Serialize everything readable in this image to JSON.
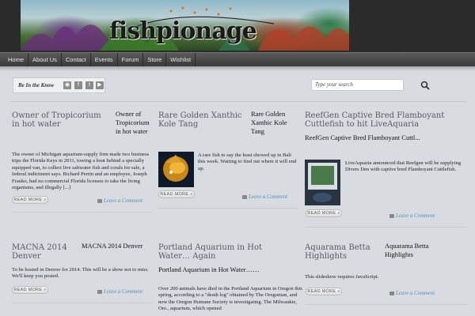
{
  "site": {
    "logo_text": "fishpionage"
  },
  "nav": {
    "items": [
      "Home",
      "About Us",
      "Contact",
      "Events",
      "Forum",
      "Store",
      "Wishlist"
    ]
  },
  "social": {
    "label": "Be In the Know",
    "icons": [
      "rss-icon",
      "facebook-icon",
      "twitter-icon",
      "youtube-icon"
    ]
  },
  "search": {
    "placeholder": "Type your search"
  },
  "posts": [
    {
      "title": "Owner of Tropicorium in hot water",
      "subtitle": "Owner of Tropicorium in hot water",
      "excerpt": "The owner of Michigan aquarium-supply firm made two business trips the Florida Keys in 2011, towing a boat behind a specially equipped van, to collect live saltwater fish and corals for sale, a federal indictment says. Richard Perrin and an employee, Joseph Franko, had no commercial Florida licenses to take the living organisms, and illegally [...]",
      "read_more": "READ MORE »",
      "comment": "Leave a Comment"
    },
    {
      "title": "Rare Golden Xanthic Kole Tang",
      "subtitle": "Rare Golden Xanthic Kole Tang",
      "excerpt": "A rare fish to say the least showed up in Bali this week. Waiting to find out where it will end up.",
      "read_more": "READ MORE »",
      "comment": "Leave a Comment"
    },
    {
      "title": "ReefGen Captive Bred Flamboyant Cuttlefish to hit LiveAquaria",
      "subtitle": "ReefGen Captive Bred Flamboyant Cuttl...",
      "excerpt": "LiveAquaria announced that Reefgen will be supplying Divers Den with captive bred Flamboyant Cuttlefish.",
      "read_more": "READ MORE »",
      "comment": "Leave a Comment"
    },
    {
      "title": "MACNA 2014 Denver",
      "subtitle": "MACNA 2014 Denver",
      "excerpt": "To be hosted in Denver for 2014. This will be a show not to miss. We'll keep you posted.",
      "read_more": "READ MORE »",
      "comment": "Leave a Comment"
    },
    {
      "title": "Portland Aquarium in Hot Water… Again",
      "subtitle": "Portland Aquarium in Hot Water……",
      "excerpt": "Over 200 animals have died in the Portland Aquarium in Oregon this spring, according to a \"death log\" obtained by The Oregonian, and now the Oregon Humane Society is investigating. The Milwaukie, Ore., aquarium, which opened",
      "read_more": "",
      "comment": ""
    },
    {
      "title": "Aquarama Betta Highlights",
      "subtitle": "Aquarama Betta Highlights",
      "excerpt": "This slideshow requires JavaScript.",
      "read_more": "READ MORE »",
      "comment": "Leave a Comment"
    }
  ]
}
